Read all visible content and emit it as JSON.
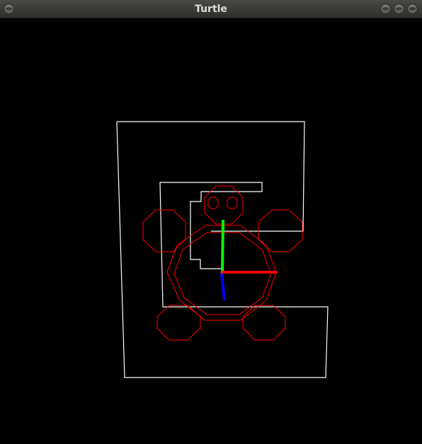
{
  "window": {
    "title": "Turtle",
    "buttons": [
      "close-button",
      "minimize-button",
      "maximize-button"
    ]
  },
  "scene": {
    "background_color": "#000000",
    "path_color": "#ffffff",
    "turtle_color": "#ff0000",
    "axis_colors": {
      "x": "#ff0000",
      "y": "#00ff00",
      "z": "#0000ff"
    }
  }
}
